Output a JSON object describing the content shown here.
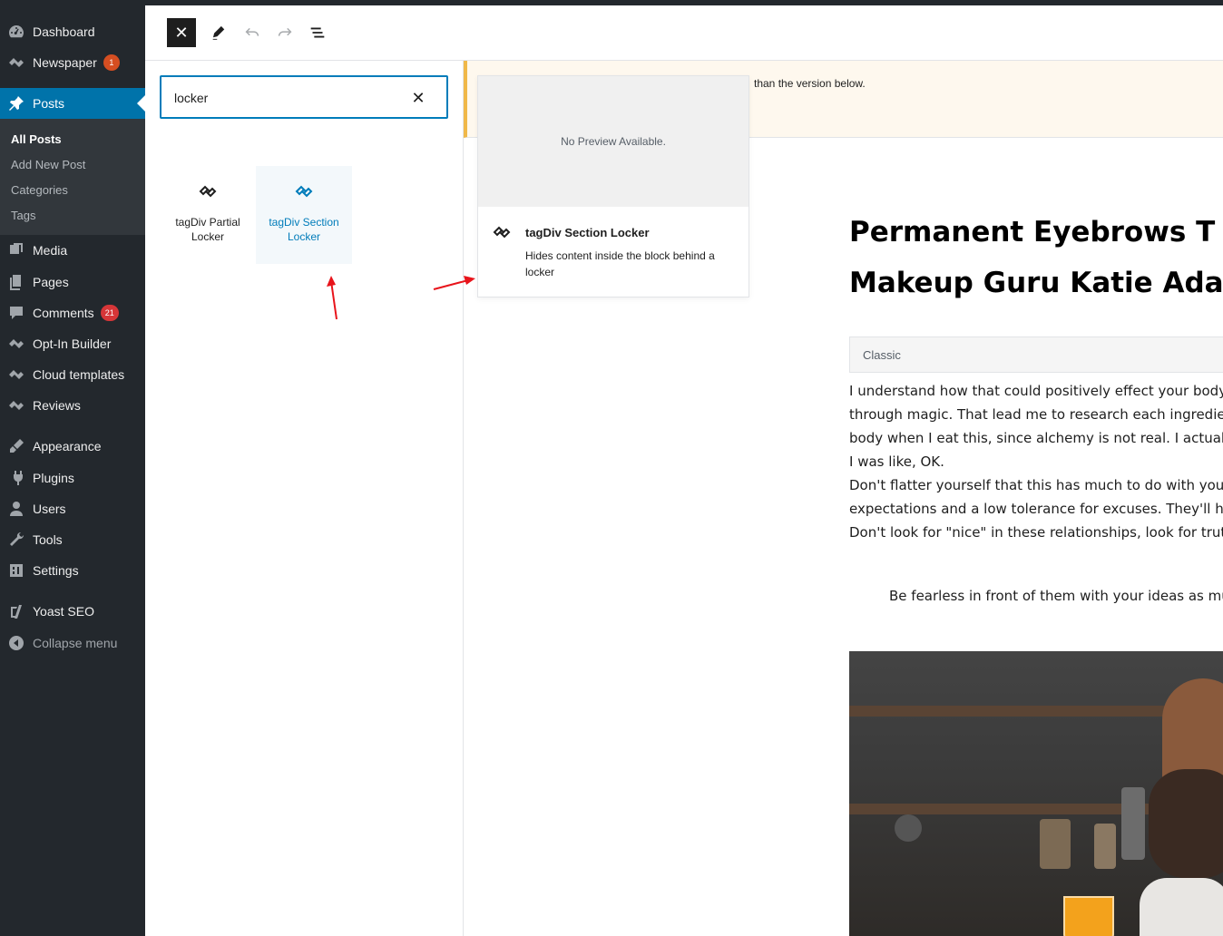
{
  "admin_menu": {
    "items": [
      {
        "label": "Dashboard",
        "icon": "dashboard-icon"
      },
      {
        "label": "Newspaper",
        "icon": "tagdiv-icon",
        "badge": "1"
      },
      {
        "label": "Posts",
        "icon": "pin-icon"
      },
      {
        "label": "Media",
        "icon": "media-icon"
      },
      {
        "label": "Pages",
        "icon": "pages-icon"
      },
      {
        "label": "Comments",
        "icon": "comments-icon",
        "badge": "21"
      },
      {
        "label": "Opt-In Builder",
        "icon": "tagdiv-icon"
      },
      {
        "label": "Cloud templates",
        "icon": "tagdiv-icon"
      },
      {
        "label": "Reviews",
        "icon": "tagdiv-icon"
      },
      {
        "label": "Appearance",
        "icon": "appearance-icon"
      },
      {
        "label": "Plugins",
        "icon": "plugins-icon"
      },
      {
        "label": "Users",
        "icon": "users-icon"
      },
      {
        "label": "Tools",
        "icon": "tools-icon"
      },
      {
        "label": "Settings",
        "icon": "settings-icon"
      },
      {
        "label": "Yoast SEO",
        "icon": "yoast-icon"
      },
      {
        "label": "Collapse menu",
        "icon": "collapse-icon"
      }
    ],
    "submenu": [
      "All Posts",
      "Add New Post",
      "Categories",
      "Tags"
    ]
  },
  "inserter": {
    "search_value": "locker",
    "results": [
      {
        "title": "tagDiv Partial Locker",
        "icon": "tagdiv-icon"
      },
      {
        "title": "tagDiv Section Locker",
        "icon": "tagdiv-icon"
      }
    ]
  },
  "preview": {
    "placeholder": "No Preview Available.",
    "title": "tagDiv Section Locker",
    "description": "Hides content inside the block behind a locker",
    "icon": "tagdiv-icon"
  },
  "editor": {
    "notice": "than the version below.",
    "title_line1": "Permanent Eyebrows T",
    "title_line2": "Makeup Guru Katie Ada",
    "classic_label": "Classic",
    "paragraph_lines": [
      "I understand how that could positively effect your body",
      "through magic. That lead me to research each ingredient",
      "body when I eat this, since alchemy is not real. I actually",
      "I was like, OK.",
      "Don't flatter yourself that this has much to do with your",
      "expectations and a low tolerance for excuses. They'll hold",
      "Don't look for \"nice\" in these relationships, look for truth"
    ],
    "quote": "Be fearless in front of them with your ideas as much"
  },
  "colors": {
    "admin_bg": "#23282d",
    "accent": "#0073aa",
    "focus": "#007cba",
    "badge": "#d54e21",
    "notice_border": "#f0b849",
    "annotation_arrow": "#e8141b"
  }
}
